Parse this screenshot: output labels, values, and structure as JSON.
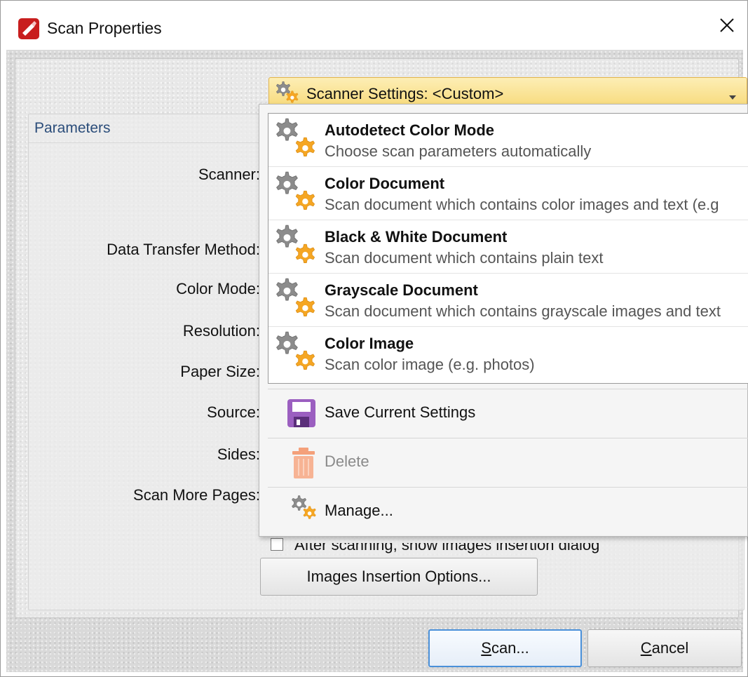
{
  "window": {
    "title": "Scan Properties"
  },
  "scanner_settings": {
    "label": "Scanner Settings:",
    "value": "<Custom>"
  },
  "parameters": {
    "group_title": "Parameters",
    "labels": {
      "scanner": "Scanner:",
      "data_transfer_method": "Data Transfer Method:",
      "color_mode": "Color Mode:",
      "resolution": "Resolution:",
      "paper_size": "Paper Size:",
      "source": "Source:",
      "sides": "Sides:",
      "scan_more_pages": "Scan More Pages:"
    },
    "after_scanning_checkbox": "After scanning, show images insertion dialog",
    "images_insertion_button": "Images Insertion Options..."
  },
  "presets": [
    {
      "title": "Autodetect Color Mode",
      "desc": "Choose scan parameters automatically"
    },
    {
      "title": "Color Document",
      "desc": "Scan document which contains color images and text (e.g"
    },
    {
      "title": "Black & White Document",
      "desc": "Scan document which contains plain text"
    },
    {
      "title": "Grayscale Document",
      "desc": "Scan document which contains grayscale images and text"
    },
    {
      "title": "Color Image",
      "desc": "Scan color image (e.g. photos)"
    }
  ],
  "menu": {
    "save": "Save Current Settings",
    "delete": "Delete",
    "manage": "Manage..."
  },
  "buttons": {
    "scan_u": "S",
    "scan_rest": "can...",
    "cancel_u": "C",
    "cancel_rest": "ancel"
  },
  "colors": {
    "accent_gear_orange": "#f5a623",
    "gear_gray": "#8a8a8a",
    "save_icon_purple": "#9b5fc0",
    "delete_icon_orange": "#f4a07a",
    "scanner_settings_bg": "#f7d978"
  },
  "icons": {
    "app": "pdf-xchange-icon",
    "close": "close-icon",
    "gears": "gears-icon",
    "save": "floppy-disk-icon",
    "delete": "trash-icon",
    "dropdown_arrow": "chevron-down-icon"
  }
}
